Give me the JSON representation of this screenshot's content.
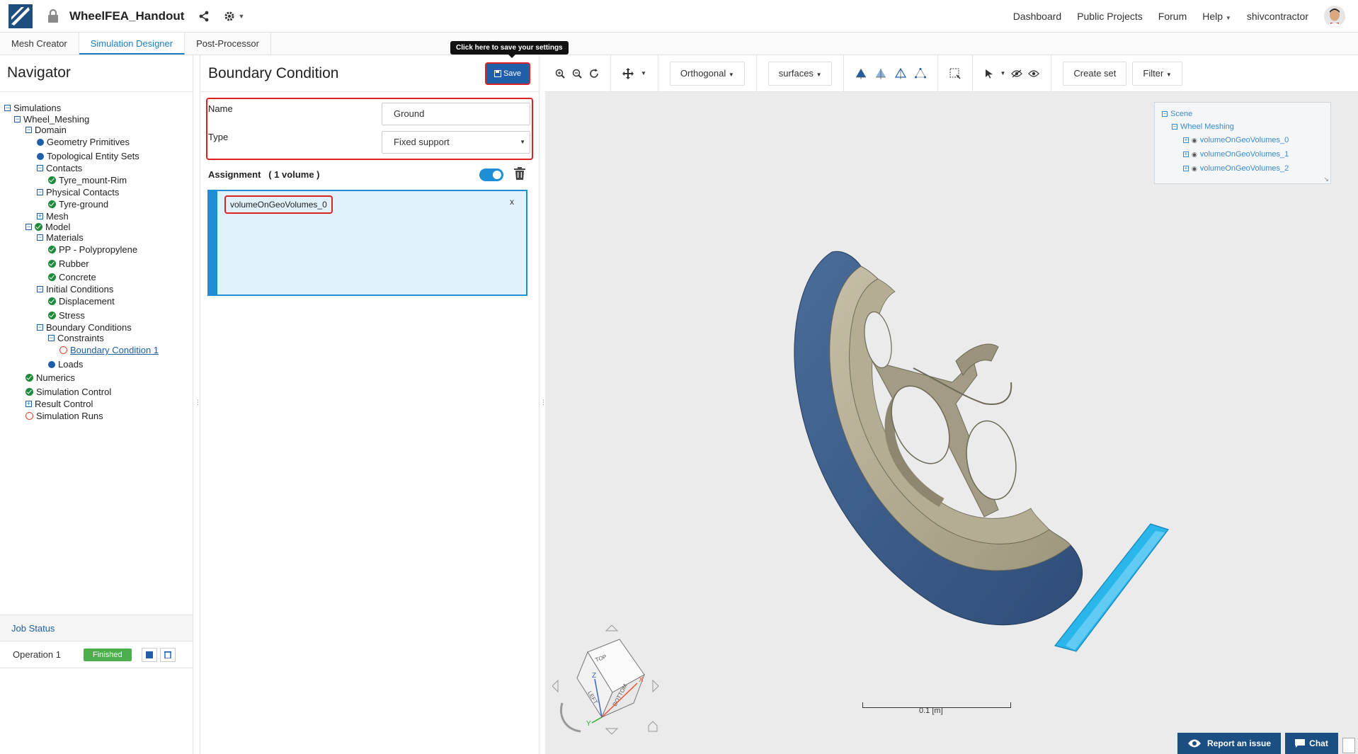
{
  "app": {
    "project_title": "WheelFEA_Handout"
  },
  "topnav": {
    "dashboard": "Dashboard",
    "public_projects": "Public Projects",
    "forum": "Forum",
    "help": "Help",
    "username": "shivcontractor"
  },
  "tabs": [
    "Mesh Creator",
    "Simulation Designer",
    "Post-Processor"
  ],
  "navigator": {
    "title": "Navigator",
    "tree": [
      "Simulations",
      "Wheel_Meshing",
      "Domain",
      "Geometry Primitives",
      "Topological Entity Sets",
      "Contacts",
      "Tyre_mount-Rim",
      "Physical Contacts",
      "Tyre-ground",
      "Mesh",
      "Model",
      "Materials",
      "PP - Polypropylene",
      "Rubber",
      "Concrete",
      "Initial Conditions",
      "Displacement",
      "Stress",
      "Boundary Conditions",
      "Constraints",
      "Boundary Condition 1",
      "Loads",
      "Numerics",
      "Simulation Control",
      "Result Control",
      "Simulation Runs"
    ]
  },
  "job_status": {
    "title": "Job Status",
    "operation": "Operation 1",
    "status": "Finished"
  },
  "bc": {
    "title": "Boundary Condition",
    "save_label": "Save",
    "tooltip": "Click here to save your settings",
    "name_label": "Name",
    "name_value": "Ground",
    "type_label": "Type",
    "type_value": "Fixed support",
    "assignment_label": "Assignment",
    "assignment_count": "( 1 volume )",
    "assigned_item": "volumeOnGeoVolumes_0",
    "remove_symbol": "x"
  },
  "viewer": {
    "projection": "Orthogonal",
    "render_mode": "surfaces",
    "create_set": "Create set",
    "filter": "Filter",
    "scale_label": "0.1 [m]",
    "report": "Report an issue",
    "chat": "Chat"
  },
  "scene": {
    "root": "Scene",
    "group": "Wheel Meshing",
    "items": [
      "volumeOnGeoVolumes_0",
      "volumeOnGeoVolumes_1",
      "volumeOnGeoVolumes_2"
    ]
  },
  "cube_labels": {
    "top": "TOP",
    "left": "LEFT",
    "bottom": "BOTTOM",
    "x": "X",
    "y": "Y",
    "z": "Z"
  },
  "colors": {
    "accent": "#1c7fc3",
    "primary": "#1f5ea8",
    "highlight": "#dd2222",
    "tyre": "#3e5f8a",
    "rim": "#aba58d",
    "ground": "#29b6ea"
  }
}
